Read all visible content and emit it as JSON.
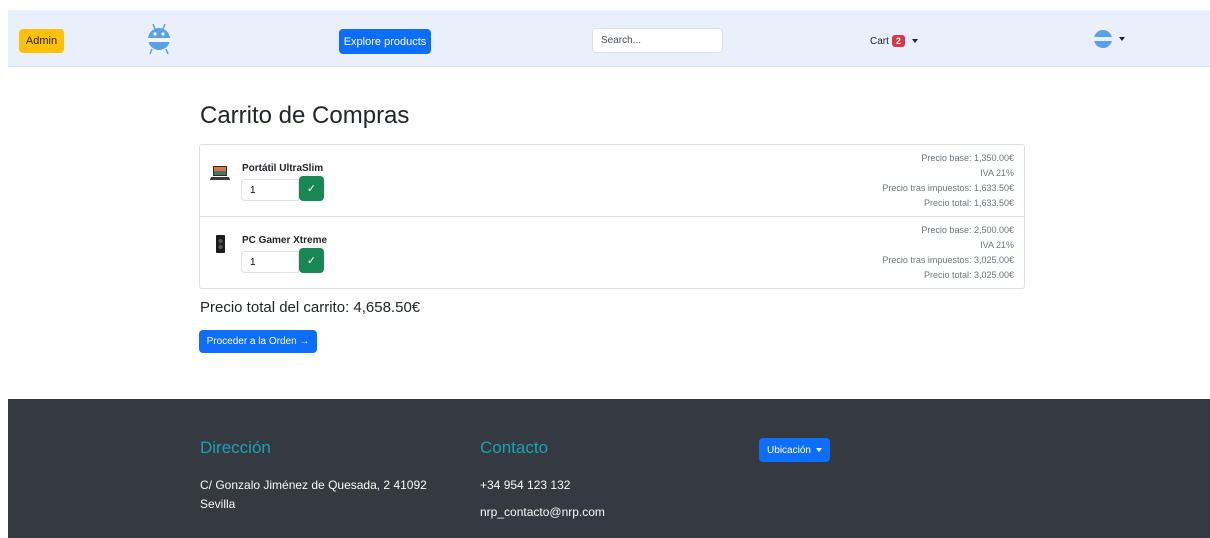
{
  "navbar": {
    "admin_label": "Admin",
    "explore_label": "Explore products",
    "search_placeholder": "Search...",
    "cart_label": "Cart",
    "cart_count": "2"
  },
  "cart": {
    "title": "Carrito de Compras",
    "items": [
      {
        "name": "Portátil UltraSlim",
        "quantity": "1",
        "confirm_icon": "✓",
        "price_base": "Precio base: 1,350.00€",
        "iva": "IVA 21%",
        "price_after_tax": "Precio tras impuestos: 1,633.50€",
        "price_total": "Precio total: 1,633.50€",
        "icon": "laptop-icon"
      },
      {
        "name": "PC Gamer Xtreme",
        "quantity": "1",
        "confirm_icon": "✓",
        "price_base": "Precio base: 2,500.00€",
        "iva": "IVA 21%",
        "price_after_tax": "Precio tras impuestos: 3,025.00€",
        "price_total": "Precio total: 3,025.00€",
        "icon": "pc-tower-icon"
      }
    ],
    "total_text": "Precio total del carrito: 4,658.50€",
    "order_button": "Proceder a la Orden →"
  },
  "footer": {
    "address_heading": "Dirección",
    "address_line1": "C/ Gonzalo Jiménez de Quesada, 2 41092",
    "address_line2": "Sevilla",
    "contact_heading": "Contacto",
    "phone": "+34 954 123 132",
    "email": "nrp_contacto@nrp.com",
    "location_button": "Ubicación"
  },
  "colors": {
    "primary": "#0d6efd",
    "warning": "#ffc107",
    "success": "#198754",
    "danger": "#dc3545",
    "footer_bg": "#343a40",
    "footer_heading": "#17a2b8"
  }
}
